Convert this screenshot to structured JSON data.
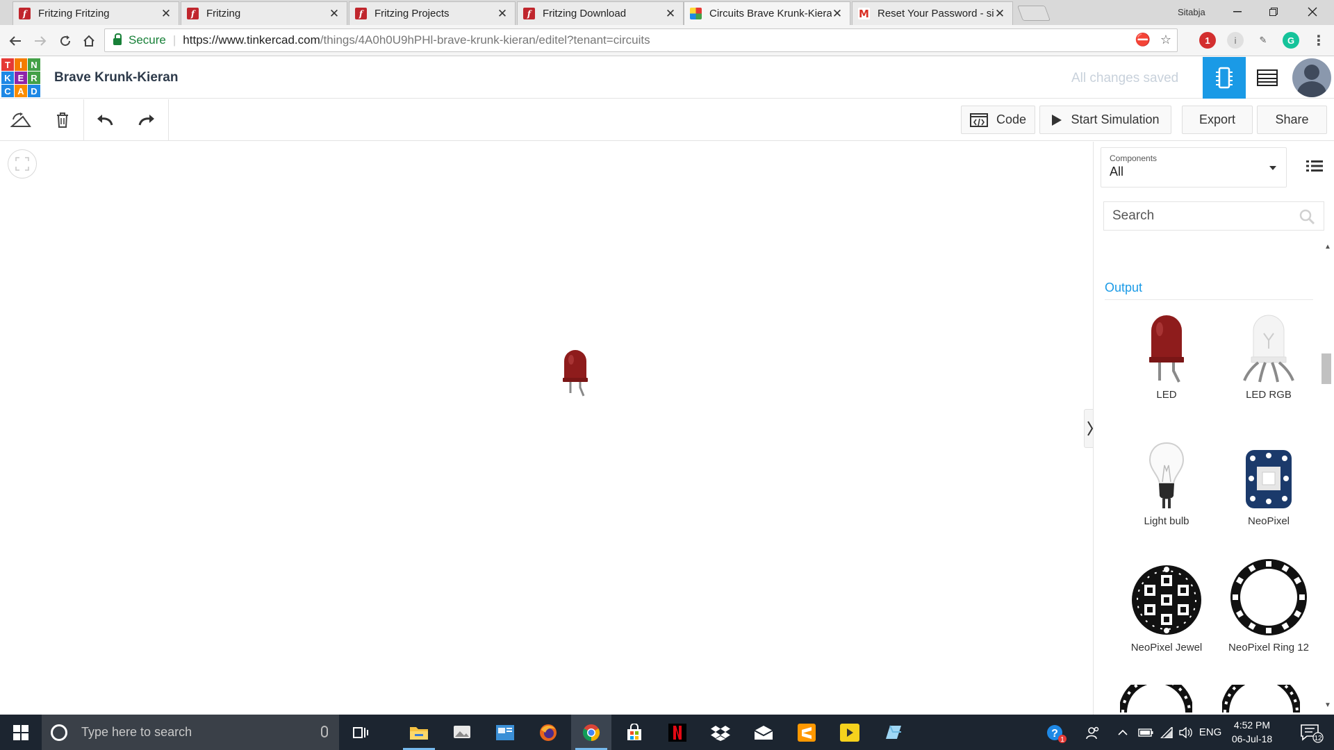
{
  "browser": {
    "tabs": [
      {
        "title": "Fritzing Fritzing",
        "favicon": "fritzing-icon"
      },
      {
        "title": "Fritzing",
        "favicon": "fritzing-icon"
      },
      {
        "title": "Fritzing Projects",
        "favicon": "fritzing-icon"
      },
      {
        "title": "Fritzing Download",
        "favicon": "fritzing-icon"
      },
      {
        "title": "Circuits Brave Krunk-Kieran",
        "favicon": "tinkercad-icon",
        "active": true
      },
      {
        "title": "Reset Your Password - sit",
        "favicon": "gmail-icon"
      }
    ],
    "close_glyph": "✕",
    "profile_name": "Sitabja",
    "secure_label": "Secure",
    "url_host": "https://www.tinkercad.com",
    "url_path": "/things/4A0h0U9hPHl-brave-krunk-kieran/editel?tenant=circuits",
    "extension_badge": "1"
  },
  "header": {
    "logo_letters": [
      "T",
      "I",
      "N",
      "K",
      "E",
      "R",
      "C",
      "A",
      "D"
    ],
    "logo_colors": [
      "#e53935",
      "#f57c00",
      "#43a047",
      "#1e88e5",
      "#8e24aa",
      "#43a047",
      "#1e88e5",
      "#fb8c00",
      "#1e88e5"
    ],
    "design_title": "Brave Krunk-Kieran",
    "save_status": "All changes saved",
    "accent": "#1a9ae6"
  },
  "toolbar": {
    "code_label": "Code",
    "simulate_label": "Start Simulation",
    "export_label": "Export",
    "share_label": "Share"
  },
  "panel": {
    "components_label": "Components",
    "components_value": "All",
    "search_placeholder": "Search",
    "section_title": "Output",
    "components": [
      {
        "name": "LED",
        "icon": "led-icon"
      },
      {
        "name": "LED RGB",
        "icon": "led-rgb-icon"
      },
      {
        "name": "Light bulb",
        "icon": "light-bulb-icon"
      },
      {
        "name": "NeoPixel",
        "icon": "neopixel-icon"
      },
      {
        "name": "NeoPixel Jewel",
        "icon": "neopixel-jewel-icon"
      },
      {
        "name": "NeoPixel Ring 12",
        "icon": "neopixel-ring-icon"
      }
    ]
  },
  "taskbar": {
    "search_placeholder": "Type here to search",
    "language": "ENG",
    "time": "4:52 PM",
    "date": "06-Jul-18",
    "notification_count": "12",
    "help_badge": "1"
  }
}
